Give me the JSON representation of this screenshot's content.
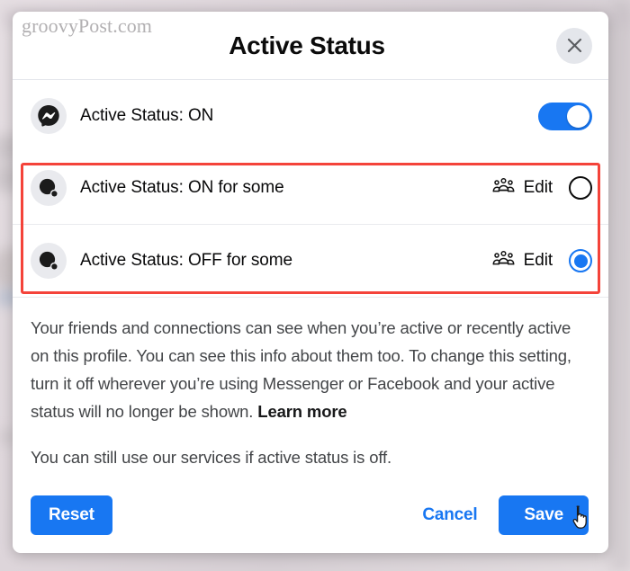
{
  "watermark": "groovyPost.com",
  "header": {
    "title": "Active Status",
    "close_label": "Close",
    "close_icon": "close-icon"
  },
  "rows": [
    {
      "icon": "messenger-icon",
      "label": "Active Status: ON",
      "control": "toggle",
      "toggle_on": true,
      "has_edit": false
    },
    {
      "icon": "presence-dot-icon",
      "label": "Active Status: ON for some",
      "control": "radio",
      "selected": false,
      "has_edit": true,
      "edit_label": "Edit",
      "edit_icon": "people-group-icon"
    },
    {
      "icon": "presence-dot-icon",
      "label": "Active Status: OFF for some",
      "control": "radio",
      "selected": true,
      "has_edit": true,
      "edit_label": "Edit",
      "edit_icon": "people-group-icon"
    }
  ],
  "body": {
    "paragraph_1_part_1": "Your friends and connections can see when you’re active or recently active on this profile. You can see this info about them too. To change this setting, turn it off wherever you’re using Messenger or Facebook and your active status will no longer be shown. ",
    "learn_more": "Learn more",
    "paragraph_2": "You can still use our services if active status is off."
  },
  "footer": {
    "reset_label": "Reset",
    "cancel_label": "Cancel",
    "save_label": "Save"
  },
  "colors": {
    "accent_blue": "#1877f2",
    "highlight_red": "#f4433a",
    "text_primary": "#080809",
    "text_secondary": "#434548"
  }
}
